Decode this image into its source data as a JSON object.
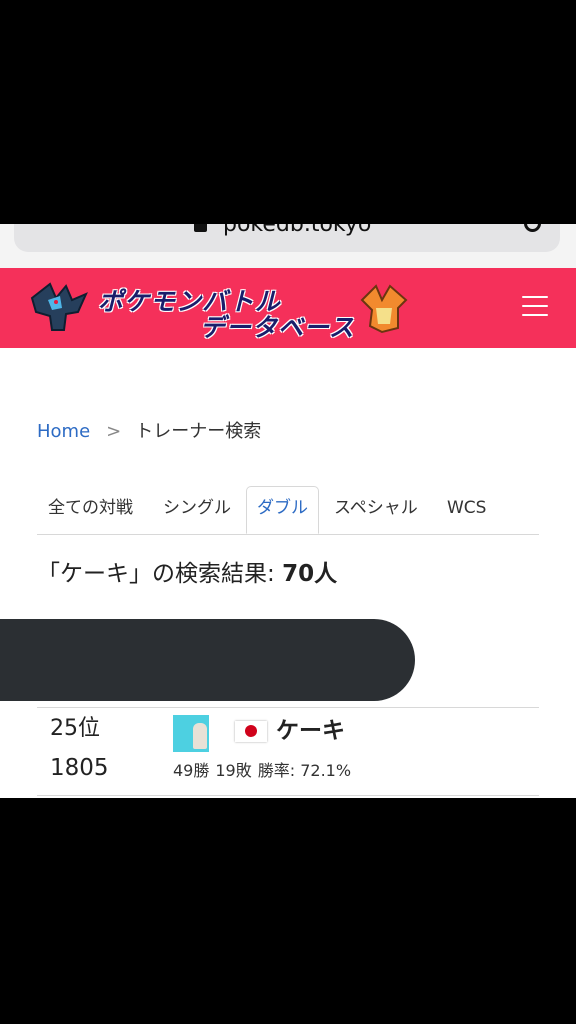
{
  "browser": {
    "url": "pokedb.tokyo"
  },
  "header": {
    "logo_line1": "ポケモンバトル",
    "logo_line2": "データベース",
    "brand_color": "#f5305a"
  },
  "breadcrumb": {
    "home": "Home",
    "separator": ">",
    "current": "トレーナー検索"
  },
  "tabs": [
    {
      "label": "全ての対戦",
      "active": false
    },
    {
      "label": "シングル",
      "active": false
    },
    {
      "label": "ダブル",
      "active": true
    },
    {
      "label": "スペシャル",
      "active": false
    },
    {
      "label": "WCS",
      "active": false
    }
  ],
  "results": {
    "title_prefix": "「ケーキ」の検索結果: ",
    "count": "70人"
  },
  "rows": [
    {
      "rank": "25位",
      "rating": "1805",
      "name": "ケーキ",
      "wins": "49勝",
      "losses": "19敗",
      "win_rate": "勝率: 72.1%"
    }
  ]
}
